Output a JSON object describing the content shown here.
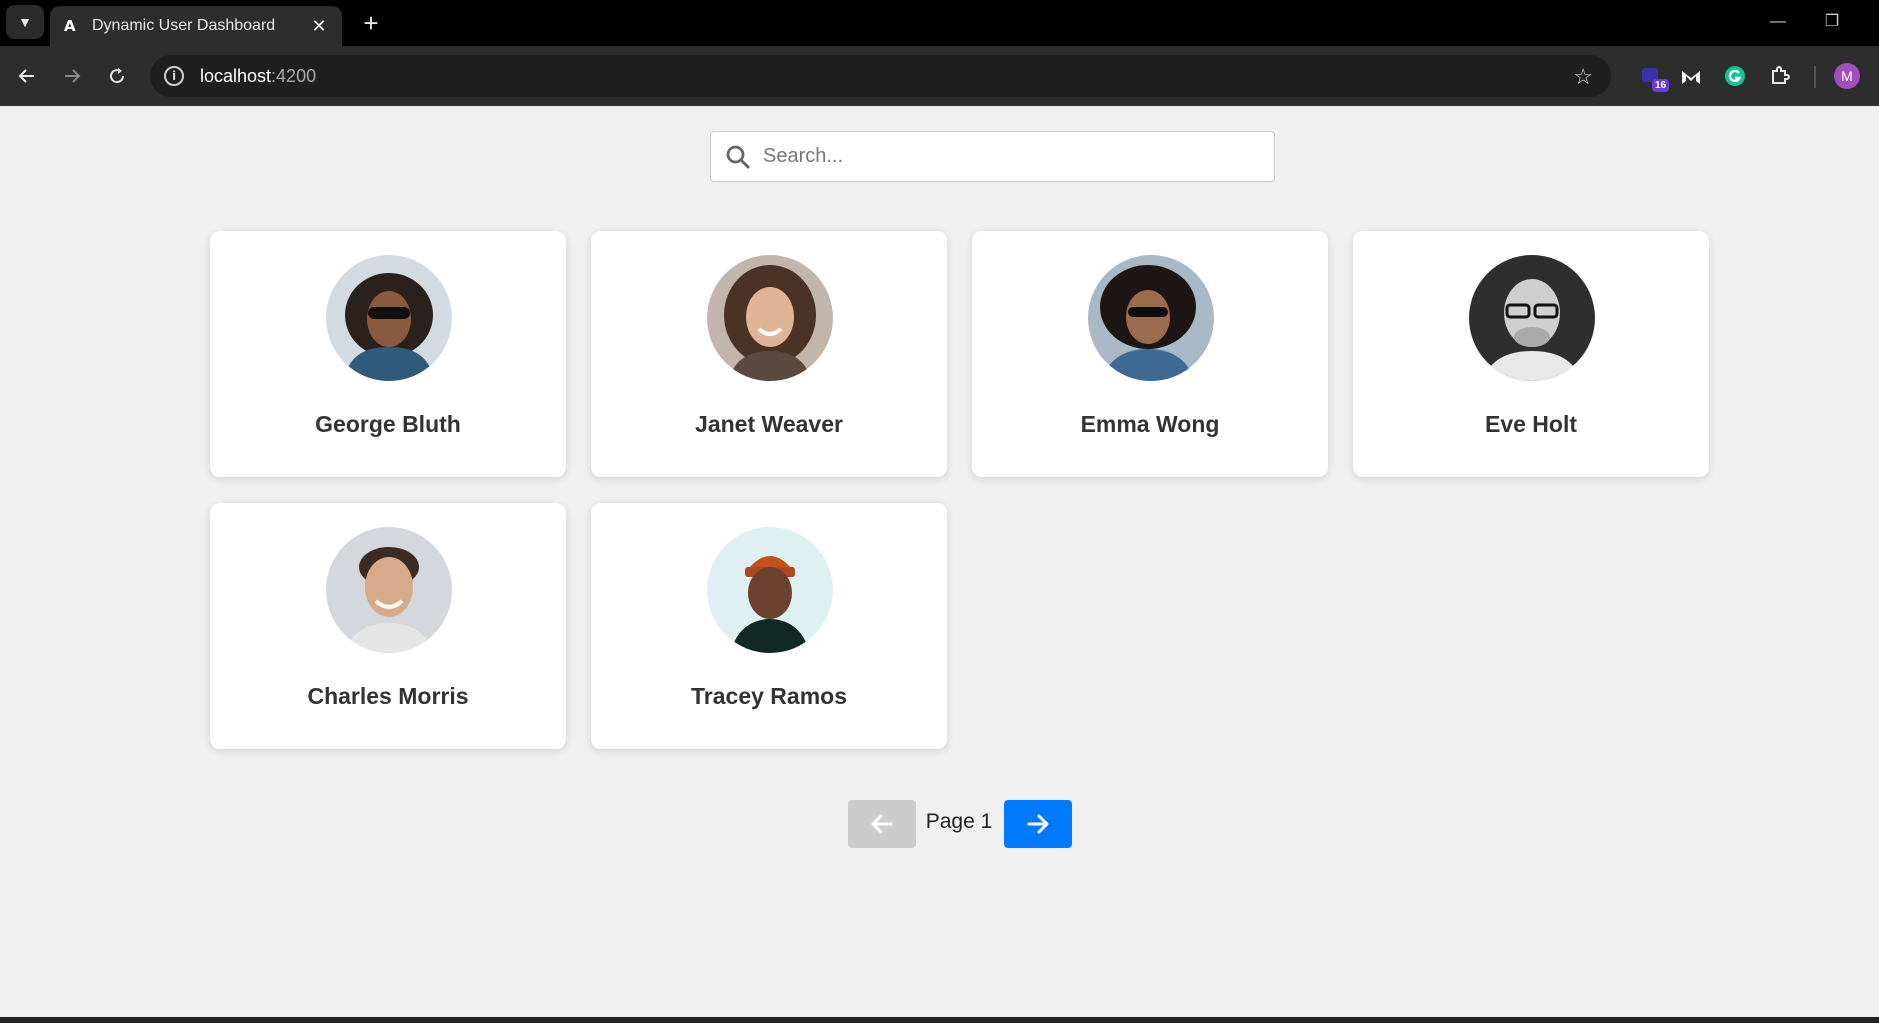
{
  "browser": {
    "tab_title": "Dynamic User Dashboard",
    "tab_favicon": "A",
    "url_host": "localhost",
    "url_port": ":4200",
    "extension_badge": "16",
    "profile_initial": "M"
  },
  "search": {
    "placeholder": "Search..."
  },
  "users": [
    {
      "name": "George Bluth",
      "avatar_bg": "#c9d3dc"
    },
    {
      "name": "Janet Weaver",
      "avatar_bg": "#b7aaa0"
    },
    {
      "name": "Emma Wong",
      "avatar_bg": "#9fb0c0"
    },
    {
      "name": "Eve Holt",
      "avatar_bg": "#3a3a3a"
    },
    {
      "name": "Charles Morris",
      "avatar_bg": "#cfd3d9"
    },
    {
      "name": "Tracey Ramos",
      "avatar_bg": "#d9eef0"
    }
  ],
  "pagination": {
    "label": "Page 1"
  },
  "colors": {
    "primary": "#007bff",
    "disabled": "#cccccc",
    "page_bg": "#f0f0f0"
  }
}
